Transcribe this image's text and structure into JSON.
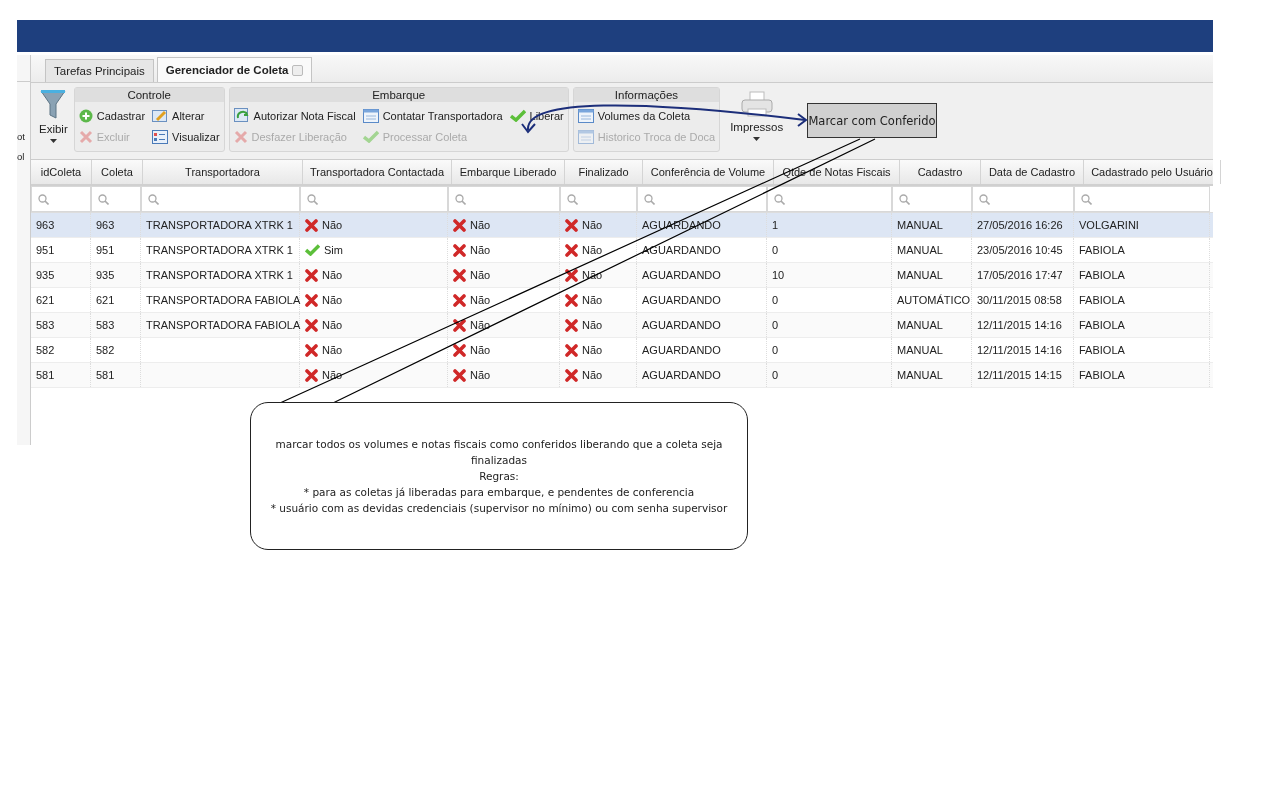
{
  "left_panel": {
    "fragments": [
      "ot",
      "ol"
    ]
  },
  "tabs": [
    {
      "label": "Tarefas Principais",
      "selected": false,
      "closable": false
    },
    {
      "label": "Gerenciador de Coleta",
      "selected": true,
      "closable": true
    }
  ],
  "toolbar": {
    "exibir": {
      "label": "Exibir"
    },
    "groups": [
      {
        "title": "Controle",
        "buttons": [
          {
            "label": "Cadastrar",
            "kind": "add",
            "disabled": false
          },
          {
            "label": "Excluir",
            "kind": "remove",
            "disabled": true
          },
          {
            "label": "Alterar",
            "kind": "edit",
            "disabled": false
          },
          {
            "label": "Visualizar",
            "kind": "view",
            "disabled": false
          }
        ]
      },
      {
        "title": "Embarque",
        "buttons": [
          {
            "label": "Autorizar Nota Fiscal",
            "kind": "authorize",
            "disabled": false
          },
          {
            "label": "Desfazer Liberação",
            "kind": "remove",
            "disabled": true
          },
          {
            "label": "Contatar Transportadora",
            "kind": "window",
            "disabled": false
          },
          {
            "label": "Processar Coleta",
            "kind": "confirm",
            "disabled": true
          },
          {
            "label": "Liberar",
            "kind": "confirm",
            "disabled": false
          }
        ]
      },
      {
        "title": "Informações",
        "buttons": [
          {
            "label": "Volumes da Coleta",
            "kind": "window",
            "disabled": false
          },
          {
            "label": "Historico Troca de Doca",
            "kind": "window",
            "disabled": true
          }
        ]
      }
    ],
    "impressos": {
      "label": "Impressos"
    }
  },
  "table": {
    "columns": [
      {
        "label": "idColeta",
        "kind": "text"
      },
      {
        "label": "Coleta",
        "kind": "text"
      },
      {
        "label": "Transportadora",
        "kind": "text"
      },
      {
        "label": "Transportadora Contactada",
        "kind": "status"
      },
      {
        "label": "Embarque Liberado",
        "kind": "status"
      },
      {
        "label": "Finalizado",
        "kind": "status"
      },
      {
        "label": "Conferência de Volume",
        "kind": "text"
      },
      {
        "label": "Qtde de Notas Fiscais",
        "kind": "text"
      },
      {
        "label": "Cadastro",
        "kind": "text"
      },
      {
        "label": "Data de Cadastro",
        "kind": "text"
      },
      {
        "label": "Cadastrado pelo Usuário",
        "kind": "text"
      }
    ],
    "rows": [
      {
        "selected": true,
        "cells": [
          {
            "text": "963"
          },
          {
            "text": "963"
          },
          {
            "text": "TRANSPORTADORA XTRK 1"
          },
          {
            "text": "Não",
            "ok": false
          },
          {
            "text": "Não",
            "ok": false
          },
          {
            "text": "Não",
            "ok": false
          },
          {
            "text": "AGUARDANDO"
          },
          {
            "text": "1"
          },
          {
            "text": "MANUAL"
          },
          {
            "text": "27/05/2016 16:26"
          },
          {
            "text": "VOLGARINI"
          }
        ]
      },
      {
        "selected": false,
        "cells": [
          {
            "text": "951"
          },
          {
            "text": "951"
          },
          {
            "text": "TRANSPORTADORA XTRK 1"
          },
          {
            "text": "Sim",
            "ok": true
          },
          {
            "text": "Não",
            "ok": false
          },
          {
            "text": "Não",
            "ok": false
          },
          {
            "text": "AGUARDANDO"
          },
          {
            "text": "0"
          },
          {
            "text": "MANUAL"
          },
          {
            "text": "23/05/2016 10:45"
          },
          {
            "text": "FABIOLA"
          }
        ]
      },
      {
        "selected": false,
        "cells": [
          {
            "text": "935"
          },
          {
            "text": "935"
          },
          {
            "text": "TRANSPORTADORA XTRK 1"
          },
          {
            "text": "Não",
            "ok": false
          },
          {
            "text": "Não",
            "ok": false
          },
          {
            "text": "Não",
            "ok": false
          },
          {
            "text": "AGUARDANDO"
          },
          {
            "text": "10"
          },
          {
            "text": "MANUAL"
          },
          {
            "text": "17/05/2016 17:47"
          },
          {
            "text": "FABIOLA"
          }
        ]
      },
      {
        "selected": false,
        "cells": [
          {
            "text": "621"
          },
          {
            "text": "621"
          },
          {
            "text": "TRANSPORTADORA FABIOLA"
          },
          {
            "text": "Não",
            "ok": false
          },
          {
            "text": "Não",
            "ok": false
          },
          {
            "text": "Não",
            "ok": false
          },
          {
            "text": "AGUARDANDO"
          },
          {
            "text": "0"
          },
          {
            "text": "AUTOMÁTICO"
          },
          {
            "text": "30/11/2015 08:58"
          },
          {
            "text": "FABIOLA"
          }
        ]
      },
      {
        "selected": false,
        "cells": [
          {
            "text": "583"
          },
          {
            "text": "583"
          },
          {
            "text": "TRANSPORTADORA FABIOLA"
          },
          {
            "text": "Não",
            "ok": false
          },
          {
            "text": "Não",
            "ok": false
          },
          {
            "text": "Não",
            "ok": false
          },
          {
            "text": "AGUARDANDO"
          },
          {
            "text": "0"
          },
          {
            "text": "MANUAL"
          },
          {
            "text": "12/11/2015 14:16"
          },
          {
            "text": "FABIOLA"
          }
        ]
      },
      {
        "selected": false,
        "cells": [
          {
            "text": "582"
          },
          {
            "text": "582"
          },
          {
            "text": ""
          },
          {
            "text": "Não",
            "ok": false
          },
          {
            "text": "Não",
            "ok": false
          },
          {
            "text": "Não",
            "ok": false
          },
          {
            "text": "AGUARDANDO"
          },
          {
            "text": "0"
          },
          {
            "text": "MANUAL"
          },
          {
            "text": "12/11/2015 14:16"
          },
          {
            "text": "FABIOLA"
          }
        ]
      },
      {
        "selected": false,
        "cells": [
          {
            "text": "581"
          },
          {
            "text": "581"
          },
          {
            "text": ""
          },
          {
            "text": "Não",
            "ok": false
          },
          {
            "text": "Não",
            "ok": false
          },
          {
            "text": "Não",
            "ok": false
          },
          {
            "text": "AGUARDANDO"
          },
          {
            "text": "0"
          },
          {
            "text": "MANUAL"
          },
          {
            "text": "12/11/2015 14:15"
          },
          {
            "text": "FABIOLA"
          }
        ]
      }
    ]
  },
  "annotations": {
    "label_box": {
      "text": "Marcar com Conferido"
    },
    "callout": {
      "lines": [
        "marcar todos os volumes e notas fiscais como conferidos liberando que a coleta seja finalizadas",
        "Regras:",
        "* para as coletas já liberadas para embarque, e pendentes de conferencia",
        "* usuário com as devidas credenciais (supervisor no mínimo) ou com senha supervisor"
      ]
    }
  }
}
